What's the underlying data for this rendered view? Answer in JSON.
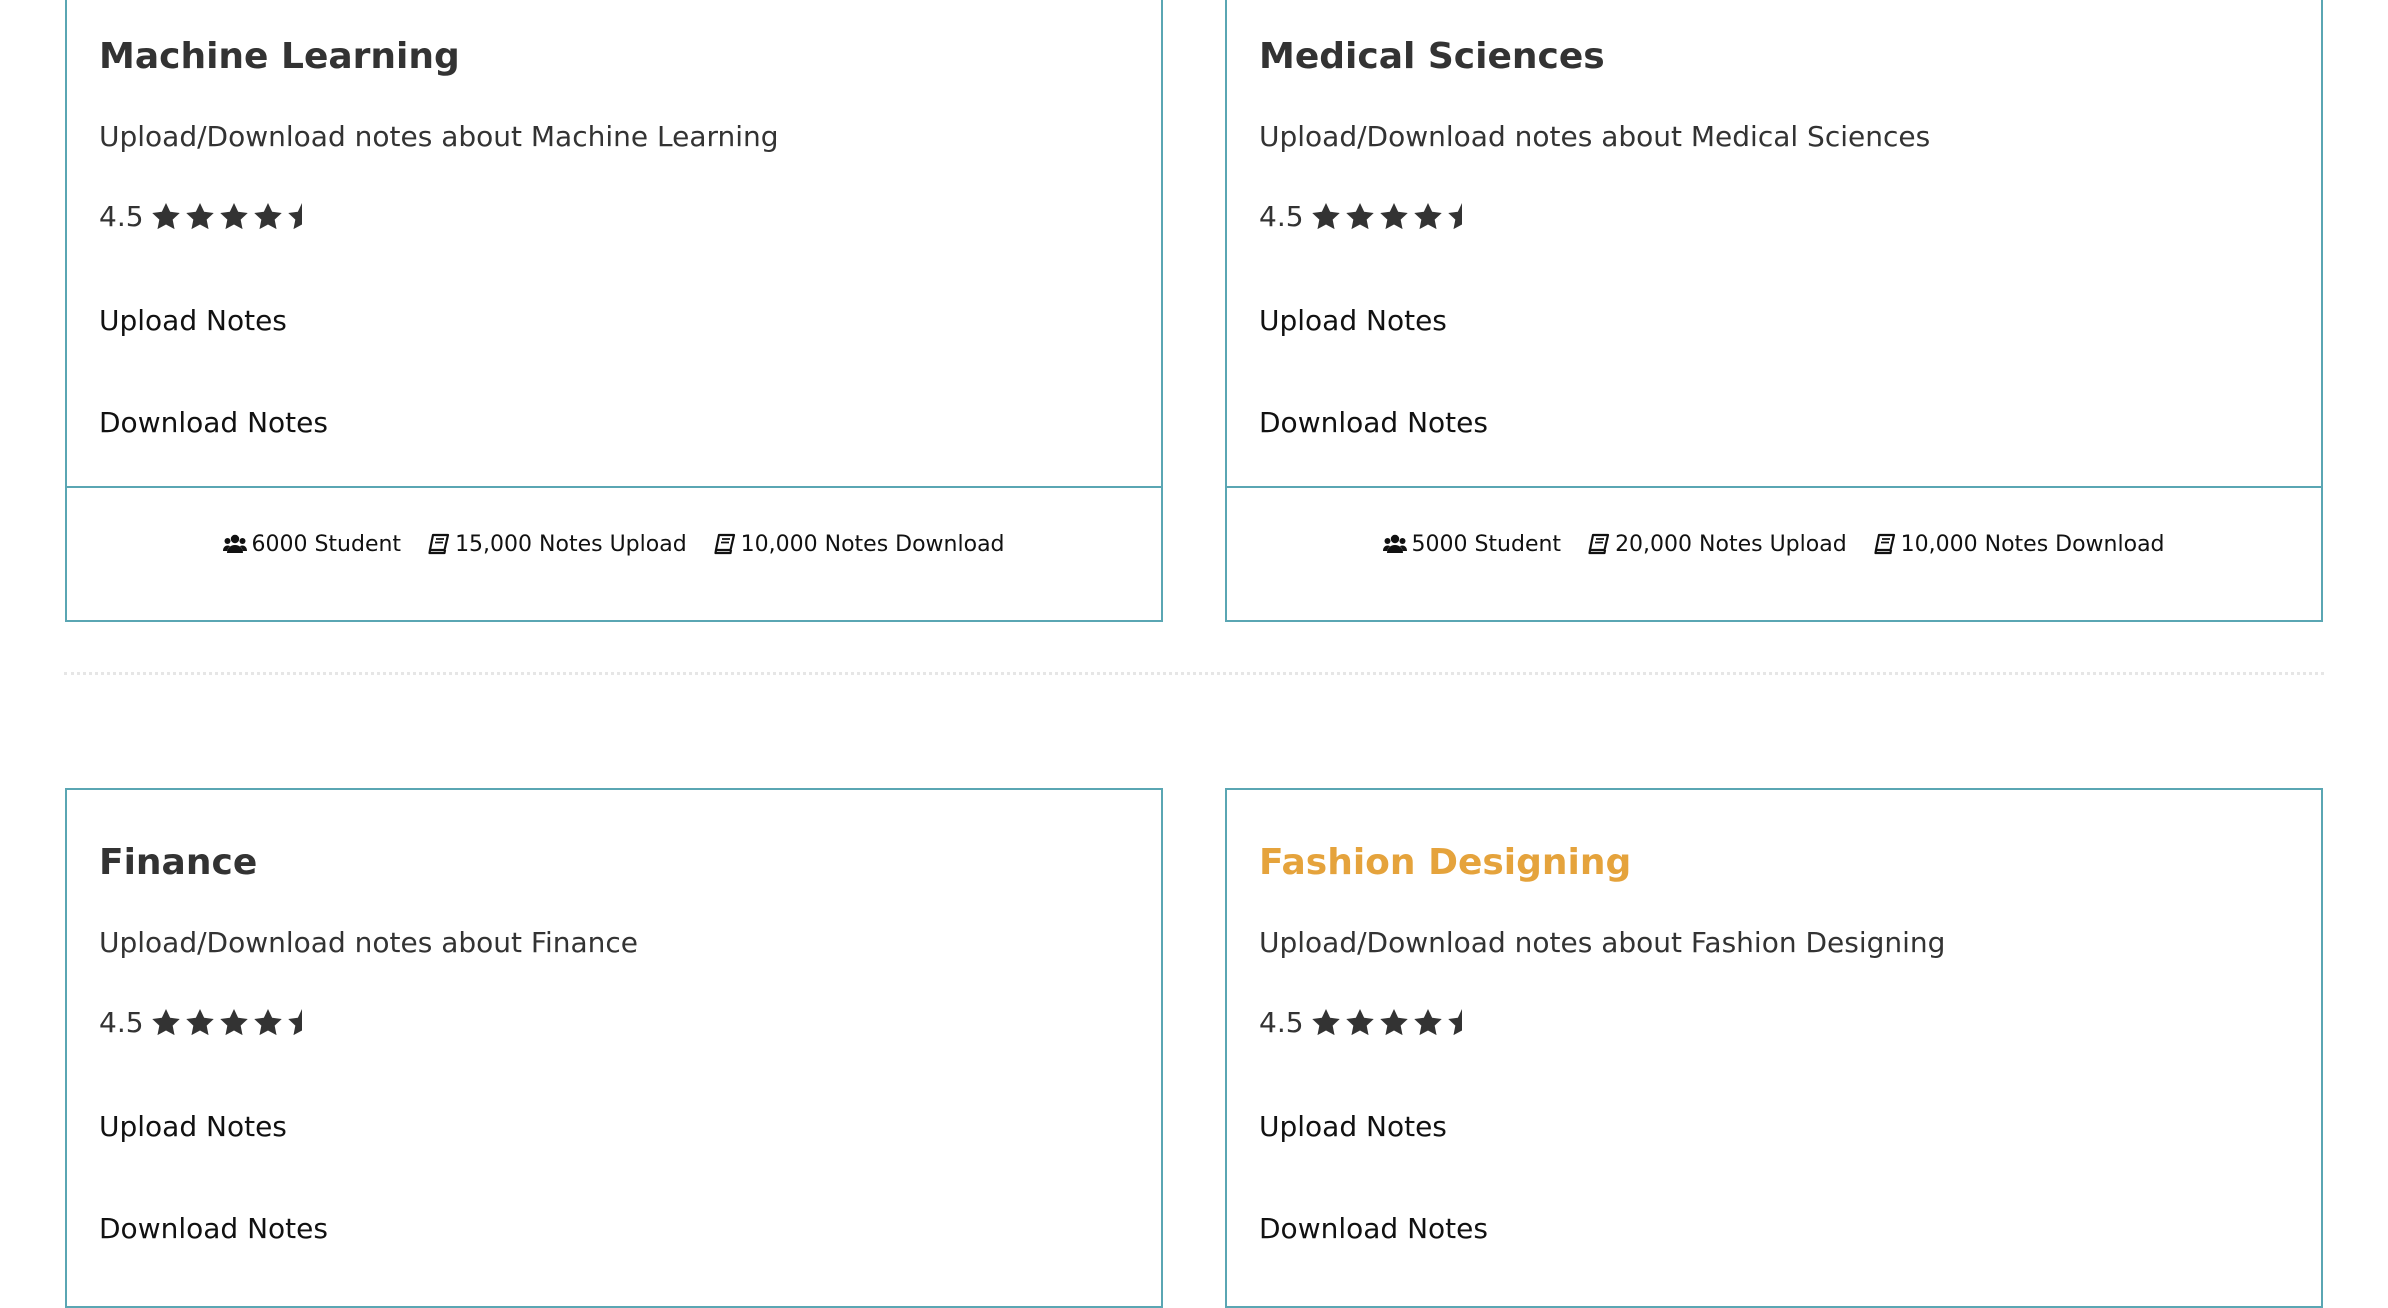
{
  "cards": [
    {
      "title": "Machine Learning",
      "description": "Upload/Download notes about Machine Learning",
      "rating": "4.5",
      "stars": 4.5,
      "upload_label": "Upload Notes",
      "download_label": "Download Notes",
      "stats": {
        "students": "6000 Student",
        "uploads": "15,000 Notes Upload",
        "downloads": "10,000 Notes Download"
      }
    },
    {
      "title": "Medical Sciences",
      "description": "Upload/Download notes about Medical Sciences",
      "rating": "4.5",
      "stars": 4.5,
      "upload_label": "Upload Notes",
      "download_label": "Download Notes",
      "stats": {
        "students": "5000 Student",
        "uploads": "20,000 Notes Upload",
        "downloads": "10,000 Notes Download"
      }
    },
    {
      "title": "Finance",
      "description": "Upload/Download notes about Finance",
      "rating": "4.5",
      "stars": 4.5,
      "upload_label": "Upload Notes",
      "download_label": "Download Notes"
    },
    {
      "title": "Fashion Designing",
      "description": "Upload/Download notes about Fashion Designing",
      "rating": "4.5",
      "stars": 4.5,
      "upload_label": "Upload Notes",
      "download_label": "Download Notes"
    }
  ],
  "colors": {
    "card_border": "#5aa6b3",
    "text": "#333333",
    "title_highlight": "#e5a33c"
  },
  "icons": {
    "star": "star-icon",
    "half_star": "half-star-icon",
    "students": "users-icon",
    "book": "book-icon"
  }
}
